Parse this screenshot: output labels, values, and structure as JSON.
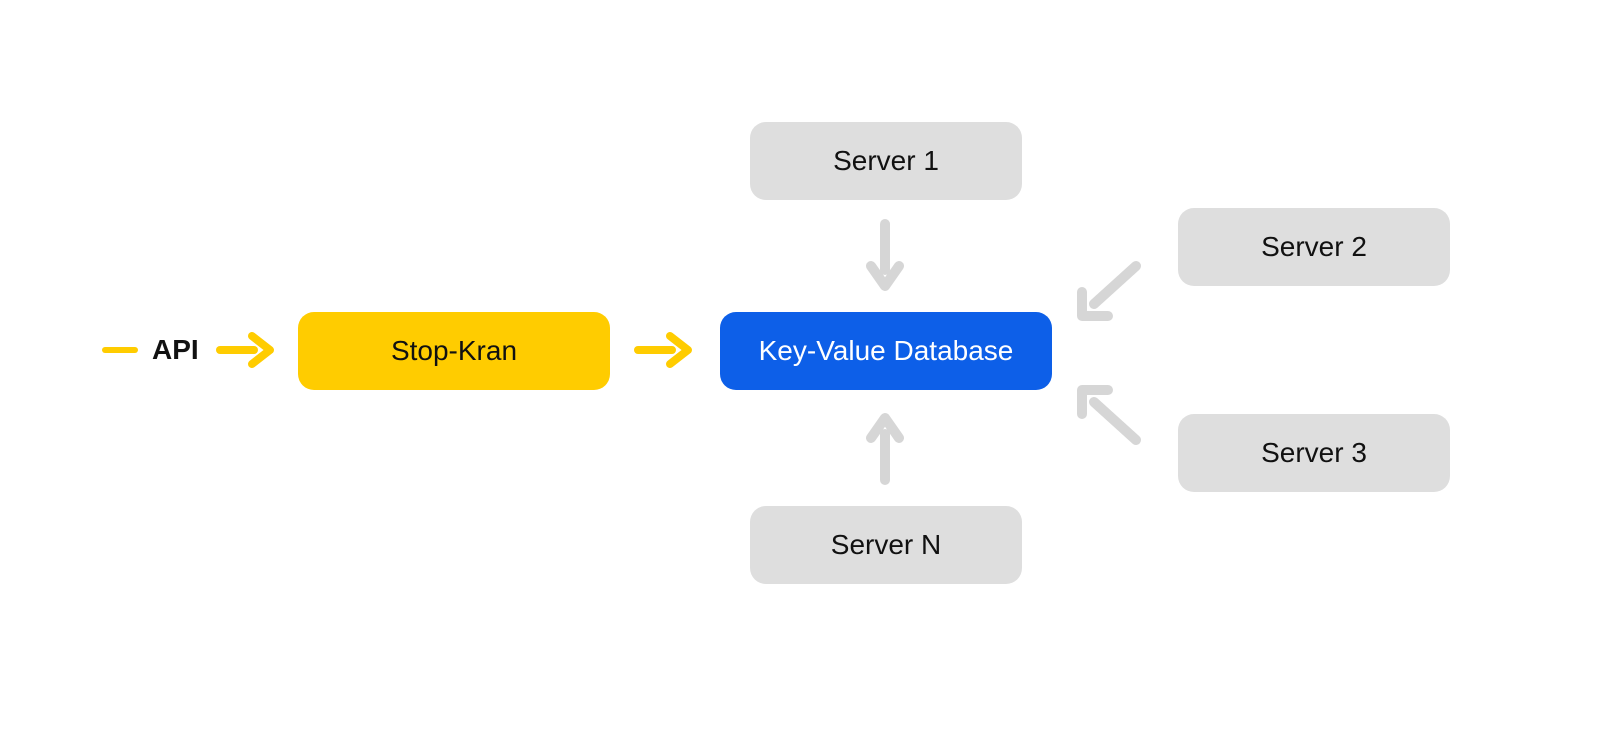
{
  "api_label": "API",
  "nodes": {
    "stop_kran": "Stop-Kran",
    "kv_db": "Key-Value Database",
    "server1": "Server 1",
    "server2": "Server 2",
    "server3": "Server 3",
    "serverN": "Server N"
  },
  "colors": {
    "yellow": "#ffcc00",
    "blue": "#0d5fe8",
    "gray": "#dedede",
    "light_arrow": "#d6d6d6"
  }
}
